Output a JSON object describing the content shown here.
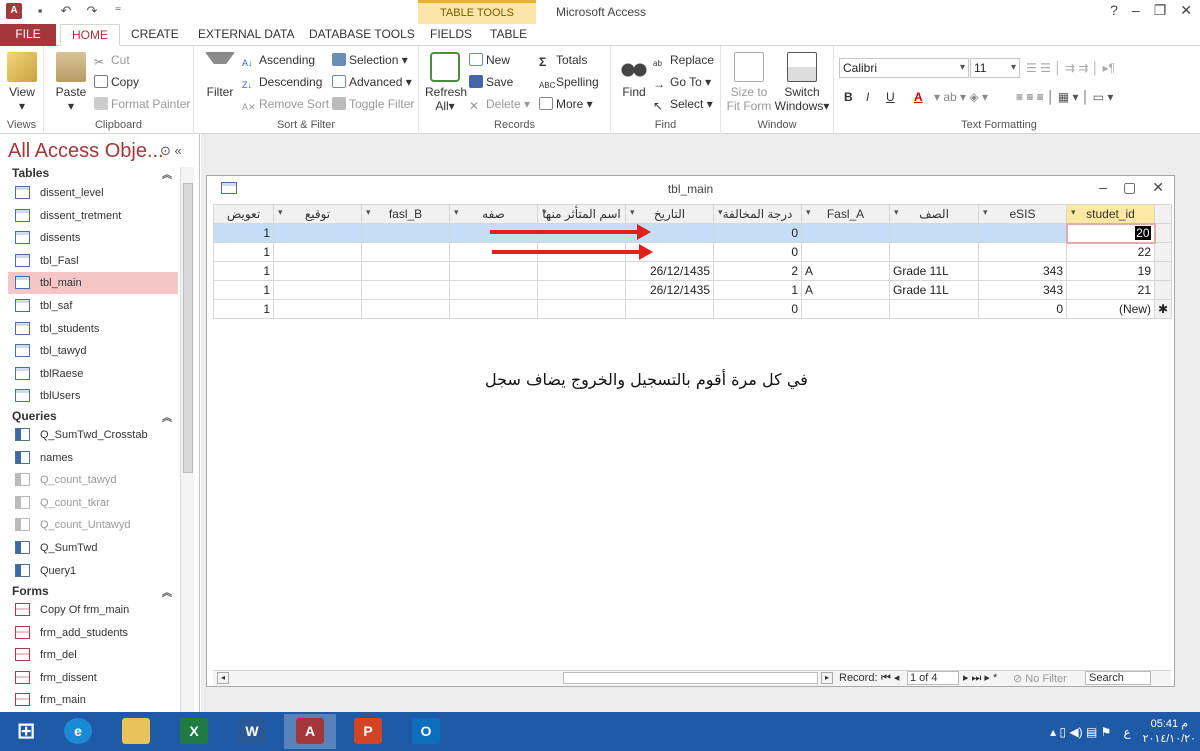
{
  "app": {
    "title": "Microsoft Access",
    "table_tools": "TABLE TOOLS"
  },
  "tabs": [
    {
      "label": "FILE"
    },
    {
      "label": "HOME"
    },
    {
      "label": "CREATE"
    },
    {
      "label": "EXTERNAL DATA"
    },
    {
      "label": "DATABASE TOOLS"
    },
    {
      "label": "FIELDS"
    },
    {
      "label": "TABLE"
    }
  ],
  "ribbon": {
    "views": {
      "view": "View",
      "label": "Views"
    },
    "clipboard": {
      "paste": "Paste",
      "cut": "Cut",
      "copy": "Copy",
      "format_painter": "Format Painter",
      "label": "Clipboard"
    },
    "sort": {
      "filter": "Filter",
      "ascending": "Ascending",
      "descending": "Descending",
      "remove_sort": "Remove Sort",
      "selection": "Selection",
      "advanced": "Advanced",
      "toggle_filter": "Toggle Filter",
      "label": "Sort & Filter"
    },
    "records": {
      "refresh": "Refresh",
      "all": "All",
      "new": "New",
      "save": "Save",
      "delete": "Delete",
      "totals": "Totals",
      "spelling": "Spelling",
      "more": "More",
      "label": "Records"
    },
    "find": {
      "find": "Find",
      "replace": "Replace",
      "goto": "Go To",
      "select": "Select",
      "label": "Find"
    },
    "window": {
      "size_to_fit": "Size to",
      "fit_form": "Fit Form",
      "switch": "Switch",
      "windows": "Windows",
      "label": "Window"
    },
    "text": {
      "font": "Calibri",
      "size": "11",
      "label": "Text Formatting",
      "bold": "B",
      "italic": "I",
      "underline": "U",
      "font_color_letter": "A"
    }
  },
  "nav": {
    "title": "All Access Obje...",
    "sections": {
      "tables": "Tables",
      "queries": "Queries",
      "forms": "Forms"
    },
    "tables": [
      "dissent_level",
      "dissent_tretment",
      "dissents",
      "tbl_Fasl",
      "tbl_main",
      "tbl_saf",
      "tbl_students",
      "tbl_tawyd",
      "tblRaese",
      "tblUsers"
    ],
    "queries": [
      "Q_SumTwd_Crosstab",
      "names",
      "Q_count_tawyd",
      "Q_count_tkrar",
      "Q_count_Untawyd",
      "Q_SumTwd",
      "Query1"
    ],
    "forms": [
      "Copy Of frm_main",
      "frm_add_students",
      "frm_del",
      "frm_dissent",
      "frm_main"
    ]
  },
  "table_window": {
    "title": "tbl_main"
  },
  "columns": [
    "تعويض",
    "توقيع",
    "fasl_B",
    "صفه",
    "اسم المتأثر منها",
    "التاريخ",
    "درجة المخالفة",
    "Fasl_A",
    "الصف",
    "eSIS",
    "studet_id"
  ],
  "rows": [
    [
      "1",
      "",
      "",
      "",
      "",
      "",
      "0",
      "",
      "",
      "",
      "20"
    ],
    [
      "1",
      "",
      "",
      "",
      "",
      "",
      "0",
      "",
      "",
      "",
      "22"
    ],
    [
      "1",
      "",
      "",
      "",
      "",
      "26/12/1435",
      "2",
      "A",
      "Grade 11L",
      "343",
      "19"
    ],
    [
      "1",
      "",
      "",
      "",
      "",
      "26/12/1435",
      "1",
      "A",
      "Grade 11L",
      "343",
      "21"
    ],
    [
      "1",
      "",
      "",
      "",
      "",
      "",
      "0",
      "",
      "",
      "0",
      "(New)"
    ]
  ],
  "annotation": "في كل مرة أقوم بالتسجيل والخروج يضاف سجل",
  "record_nav": {
    "label": "Record:",
    "position": "1 of 4",
    "no_filter": "No Filter",
    "search": "Search"
  },
  "taskbar": {
    "time": "05:41 م",
    "date": "٢٠١٤/١٠/٢٠",
    "lang": "ع"
  },
  "colors": {
    "accent": "#a4373a",
    "selection": "#f6c5c6",
    "arrow": "#e2211b",
    "taskbar": "#1f5aa7"
  }
}
